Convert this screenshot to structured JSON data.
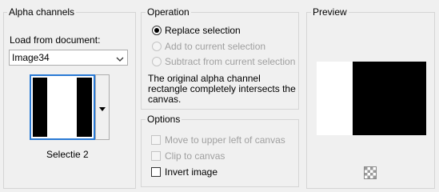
{
  "alpha_channels": {
    "title": "Alpha channels",
    "load_from_label": "Load from document:",
    "document_value": "Image34",
    "thumbnail_caption": "Selectie 2"
  },
  "operation": {
    "title": "Operation",
    "options": [
      {
        "label": "Replace selection",
        "enabled": true,
        "selected": true
      },
      {
        "label": "Add to current selection",
        "enabled": false,
        "selected": false
      },
      {
        "label": "Subtract from current selection",
        "enabled": false,
        "selected": false
      }
    ],
    "message": "The original alpha channel rectangle completely intersects the canvas."
  },
  "options": {
    "title": "Options",
    "items": [
      {
        "label": "Move to upper left of canvas",
        "enabled": false,
        "checked": false
      },
      {
        "label": "Clip to canvas",
        "enabled": false,
        "checked": false
      },
      {
        "label": "Invert image",
        "enabled": true,
        "checked": false
      }
    ]
  },
  "preview": {
    "title": "Preview"
  },
  "colors": {
    "accent": "#2a7ad5",
    "preview_black": "#000000",
    "preview_white": "#ffffff"
  }
}
